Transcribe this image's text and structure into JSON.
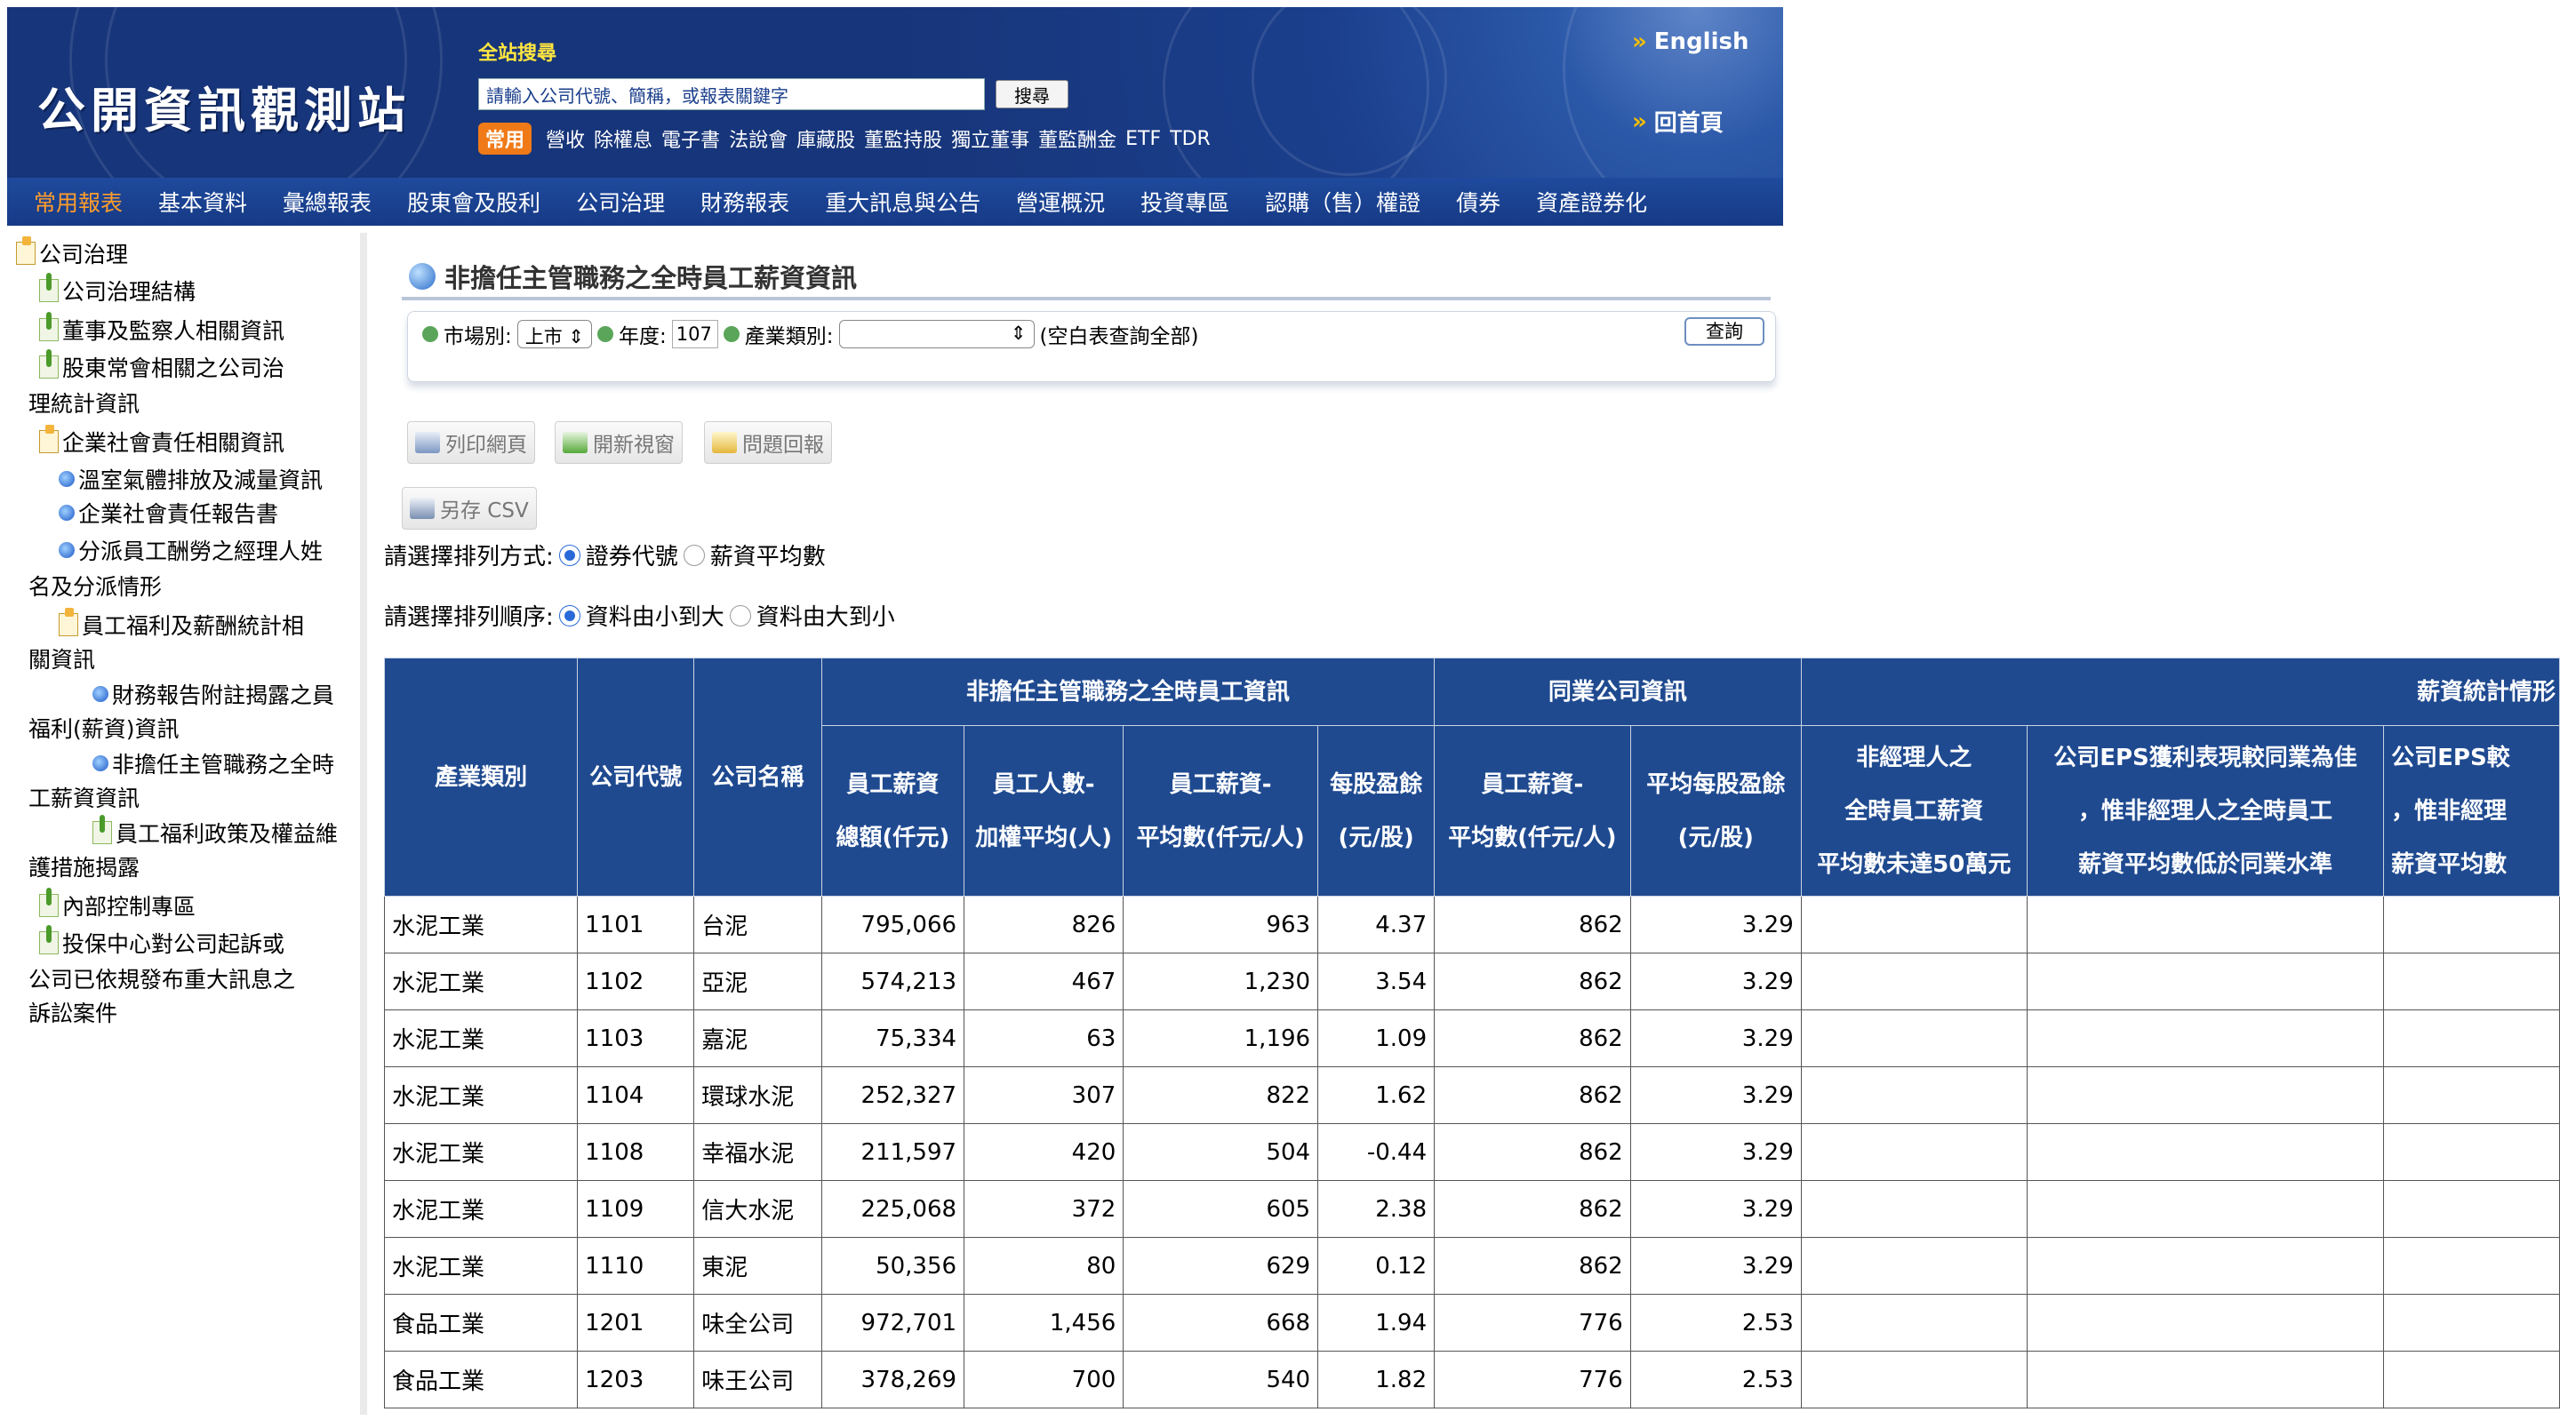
{
  "header": {
    "logo": "公開資訊觀測站",
    "search_title": "全站搜尋",
    "search_placeholder": "請輸入公司代號、簡稱，或報表關鍵字",
    "search_button": "搜尋",
    "quick_tag": "常用",
    "quick_links": [
      "營收",
      "除權息",
      "電子書",
      "法說會",
      "庫藏股",
      "董監持股",
      "獨立董事",
      "董監酬金",
      "ETF",
      "TDR"
    ],
    "english": "English",
    "home": "回首頁"
  },
  "nav": [
    "常用報表",
    "基本資料",
    "彙總報表",
    "股東會及股利",
    "公司治理",
    "財務報表",
    "重大訊息與公告",
    "營運概況",
    "投資專區",
    "認購（售）權證",
    "債券",
    "資產證券化"
  ],
  "sidebar": {
    "root": "公司治理",
    "items": [
      "公司治理結構",
      "董事及監察人相關資訊",
      "股東常會相關之公司治",
      "理統計資訊",
      "企業社會責任相關資訊",
      "溫室氣體排放及減量資訊",
      "企業社會責任報告書",
      "分派員工酬勞之經理人姓",
      "名及分派情形",
      "員工福利及薪酬統計相",
      "關資訊",
      "財務報告附註揭露之員",
      "福利(薪資)資訊",
      "非擔任主管職務之全時",
      "工薪資資訊",
      "員工福利政策及權益維",
      "護措施揭露",
      "內部控制專區",
      "投保中心對公司起訴或",
      "公司已依規發布重大訊息之",
      "訴訟案件"
    ]
  },
  "main": {
    "title": "非擔任主管職務之全時員工薪資資訊",
    "query": {
      "market_label": "市場別:",
      "market_value": "上市",
      "year_label": "年度:",
      "year_value": "107",
      "industry_label": "產業類別:",
      "industry_value": "",
      "hint": "(空白表查詢全部)",
      "submit": "查詢"
    },
    "tools": {
      "print": "列印網頁",
      "new_window": "開新視窗",
      "feedback": "問題回報",
      "save_csv": "另存 CSV"
    },
    "sort": {
      "by_label": "請選擇排列方式:",
      "by_opt1": "證券代號",
      "by_opt2": "薪資平均數",
      "order_label": "請選擇排列順序:",
      "order_opt1": "資料由小到大",
      "order_opt2": "資料由大到小"
    }
  },
  "table": {
    "group_headers": [
      "非擔任主管職務之全時員工資訊",
      "同業公司資訊",
      "薪資統計情形"
    ],
    "col_headers": {
      "industry": "產業類別",
      "code": "公司代號",
      "name": "公司名稱",
      "c1a": "員工薪資",
      "c1b": "總額(仟元)",
      "c2a": "員工人數-",
      "c2b": "加權平均(人)",
      "c3a": "員工薪資-",
      "c3b": "平均數(仟元/人)",
      "c4a": "每股盈餘",
      "c4b": "(元/股)",
      "c5a": "員工薪資-",
      "c5b": "平均數(仟元/人)",
      "c6a": "平均每股盈餘",
      "c6b": "(元/股)",
      "c7a": "非經理人之",
      "c7b": "全時員工薪資",
      "c7c": "平均數未達50萬元",
      "c8a": "公司EPS獲利表現較同業為佳",
      "c8b": "，惟非經理人之全時員工",
      "c8c": "薪資平均數低於同業水準",
      "c9a": "公司EPS較",
      "c9b": "，惟非經理",
      "c9c": "薪資平均數"
    },
    "rows": [
      [
        "水泥工業",
        "1101",
        "台泥",
        "795,066",
        "826",
        "963",
        "4.37",
        "862",
        "3.29"
      ],
      [
        "水泥工業",
        "1102",
        "亞泥",
        "574,213",
        "467",
        "1,230",
        "3.54",
        "862",
        "3.29"
      ],
      [
        "水泥工業",
        "1103",
        "嘉泥",
        "75,334",
        "63",
        "1,196",
        "1.09",
        "862",
        "3.29"
      ],
      [
        "水泥工業",
        "1104",
        "環球水泥",
        "252,327",
        "307",
        "822",
        "1.62",
        "862",
        "3.29"
      ],
      [
        "水泥工業",
        "1108",
        "幸福水泥",
        "211,597",
        "420",
        "504",
        "-0.44",
        "862",
        "3.29"
      ],
      [
        "水泥工業",
        "1109",
        "信大水泥",
        "225,068",
        "372",
        "605",
        "2.38",
        "862",
        "3.29"
      ],
      [
        "水泥工業",
        "1110",
        "東泥",
        "50,356",
        "80",
        "629",
        "0.12",
        "862",
        "3.29"
      ],
      [
        "食品工業",
        "1201",
        "味全公司",
        "972,701",
        "1,456",
        "668",
        "1.94",
        "776",
        "2.53"
      ],
      [
        "食品工業",
        "1203",
        "味王公司",
        "378,269",
        "700",
        "540",
        "1.82",
        "776",
        "2.53"
      ]
    ]
  },
  "colors": {
    "banner": "#1b3f8c",
    "nav": "#1f4a9d",
    "nav_active": "#ff9d2b",
    "table_header": "#1f4a90",
    "search_title": "#ffe640"
  }
}
